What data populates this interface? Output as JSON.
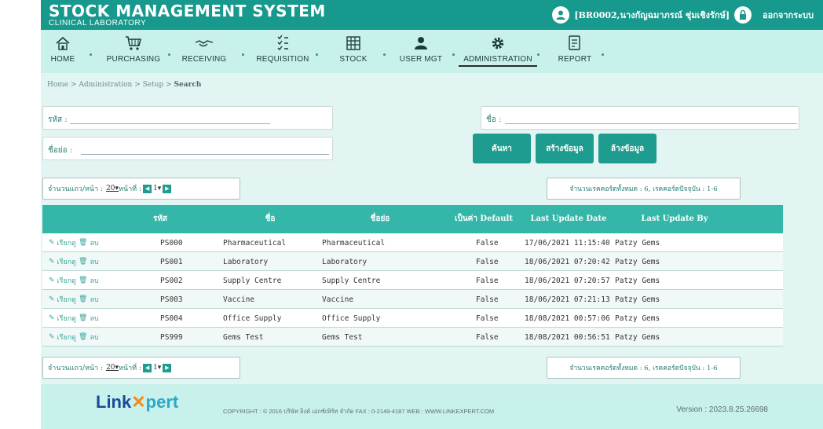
{
  "header": {
    "title": "STOCK MANAGEMENT SYSTEM",
    "subtitle": "CLINICAL LABORATORY",
    "user": "[BR0002,นางกัญฉมาภรณ์ ชุ่มเชิงรักษ์]",
    "logout": "ออกจากระบบ"
  },
  "nav": [
    {
      "label": "HOME",
      "icon": "home-icon"
    },
    {
      "label": "PURCHASING",
      "icon": "cart-icon"
    },
    {
      "label": "RECEIVING",
      "icon": "handshake-icon"
    },
    {
      "label": "REQUISITION",
      "icon": "list-icon"
    },
    {
      "label": "STOCK",
      "icon": "grid-icon"
    },
    {
      "label": "USER MGT",
      "icon": "user-icon"
    },
    {
      "label": "ADMINISTRATION",
      "icon": "gear-icon"
    },
    {
      "label": "REPORT",
      "icon": "report-icon"
    }
  ],
  "breadcrumb": {
    "path": "Home > Administration > Setup > ",
    "current": "Search"
  },
  "search": {
    "code_label": "รหัส :",
    "name_label": "ชื่อ :",
    "short_label": "ชื่อย่อ :"
  },
  "buttons": {
    "search": "ค้นหา",
    "create": "สร้างข้อมูล",
    "clear": "ล้างข้อมูล"
  },
  "pager": {
    "rows_label": "จำนวนแถว/หน้า :",
    "rows_value": "20",
    "page_label": "หน้าที่ :",
    "page_value": "1"
  },
  "record_info": "จำนวนเรคคอร์ดทั้งหมด : 6, เรคคอร์ดปัจจุบัน : 1-6",
  "table": {
    "headers": [
      "",
      "รหัส",
      "ชื่อ",
      "ชื่อย่อ",
      "เป็นค่า Default",
      "Last Update Date",
      "Last Update By"
    ],
    "edit_label": "เรียกดู",
    "delete_label": "ลบ",
    "rows": [
      {
        "code": "PS000",
        "name": "Pharmaceutical",
        "short": "Pharmaceutical",
        "default": "False",
        "date": "17/06/2021 11:15:40",
        "by": "Patzy Gems"
      },
      {
        "code": "PS001",
        "name": "Laboratory",
        "short": "Laboratory",
        "default": "False",
        "date": "18/06/2021 07:20:42",
        "by": "Patzy Gems"
      },
      {
        "code": "PS002",
        "name": "Supply Centre",
        "short": "Supply Centre",
        "default": "False",
        "date": "18/06/2021 07:20:57",
        "by": "Patzy Gems"
      },
      {
        "code": "PS003",
        "name": "Vaccine",
        "short": "Vaccine",
        "default": "False",
        "date": "18/06/2021 07:21:13",
        "by": "Patzy Gems"
      },
      {
        "code": "PS004",
        "name": "Office Supply",
        "short": "Office Supply",
        "default": "False",
        "date": "18/08/2021 00:57:06",
        "by": "Patzy Gems"
      },
      {
        "code": "PS999",
        "name": "Gems Test",
        "short": "Gems Test",
        "default": "False",
        "date": "18/08/2021 00:56:51",
        "by": "Patzy Gems"
      }
    ]
  },
  "footer": {
    "brand_a": "Link",
    "brand_b": "pert",
    "copyright": "COPYRIGHT : © 2016 บริษัท ลิงค์ เอกซ์เพิร์ท จำกัด  FAX : 0-2149-4187  WEB : WWW.LINKEXPERT.COM",
    "version": "Version : 2023.8.25.26698"
  },
  "colors": {
    "primary": "#17998d",
    "nav_bg": "#c9f1ec",
    "content_bg": "#e3f5f3",
    "table_head": "#34b7a8"
  }
}
